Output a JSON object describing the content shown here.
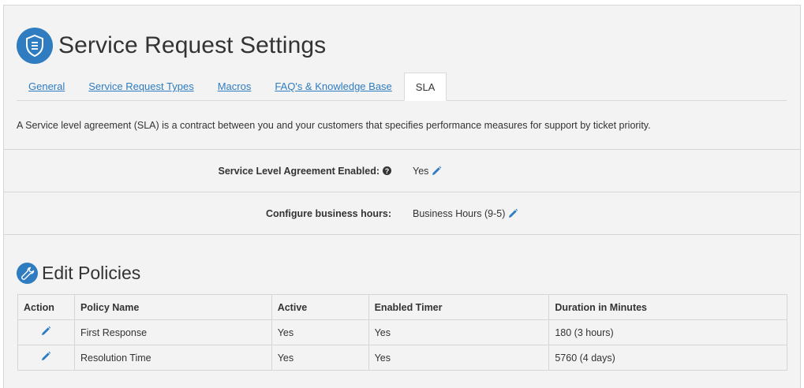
{
  "header": {
    "title": "Service Request Settings",
    "icon": "shield-icon"
  },
  "tabs": [
    {
      "label": "General",
      "active": false
    },
    {
      "label": "Service Request Types",
      "active": false
    },
    {
      "label": "Macros",
      "active": false
    },
    {
      "label": "FAQ's & Knowledge Base",
      "active": false
    },
    {
      "label": "SLA",
      "active": true
    }
  ],
  "description": "A Service level agreement (SLA) is a contract between you and your customers that specifies performance measures for support by ticket priority.",
  "settings": {
    "sla_enabled": {
      "label": "Service Level Agreement Enabled:",
      "value": "Yes"
    },
    "business_hours": {
      "label": "Configure business hours:",
      "value": "Business Hours (9-5)"
    }
  },
  "policies": {
    "title": "Edit Policies",
    "icon": "wrench-icon",
    "columns": [
      "Action",
      "Policy Name",
      "Active",
      "Enabled Timer",
      "Duration in Minutes"
    ],
    "rows": [
      {
        "name": "First Response",
        "active": "Yes",
        "timer": "Yes",
        "duration": "180 (3 hours)"
      },
      {
        "name": "Resolution Time",
        "active": "Yes",
        "timer": "Yes",
        "duration": "5760 (4 days)"
      }
    ]
  },
  "colors": {
    "accent": "#2f7cc1",
    "panel_bg": "#f3f3f3",
    "border": "#d6d6d6"
  }
}
